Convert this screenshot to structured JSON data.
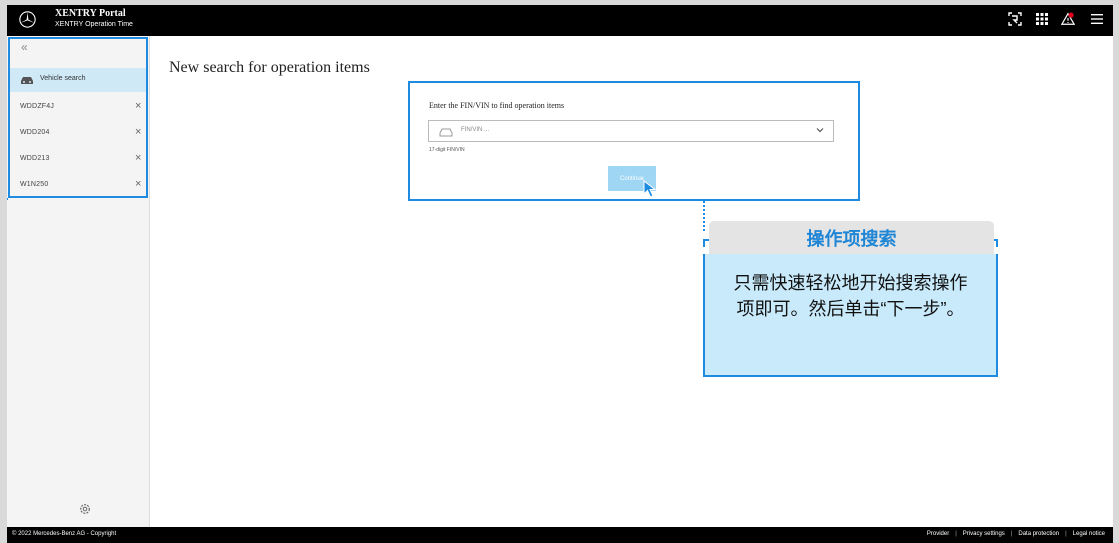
{
  "header": {
    "title": "XENTRY Portal",
    "subtitle": "XENTRY Operation Time",
    "icons": [
      "logo-star-icon",
      "scan-icon",
      "apps-grid-icon",
      "alert-icon",
      "menu-icon"
    ]
  },
  "sidebar": {
    "collapse_label": "«",
    "vehicle_search_label": "Vehicle search",
    "history": [
      {
        "label": "WDDZF4J"
      },
      {
        "label": "WDD204"
      },
      {
        "label": "WDD213"
      },
      {
        "label": "W1N250"
      }
    ],
    "close_glyph": "×"
  },
  "main": {
    "page_title": "New search for operation items",
    "search": {
      "prompt": "Enter the FIN/VIN to find operation items",
      "placeholder": "FIN/VIN ...",
      "hint": "17-digit FIN/VIN",
      "continue_label": "Continue"
    }
  },
  "callout": {
    "title": "操作项搜索",
    "body": "只需快速轻松地开始搜索操作项即可。然后单击“下一步”。"
  },
  "footer": {
    "copyright": "© 2022 Mercedes-Benz AG - Copyright",
    "links": [
      "Provider",
      "Privacy settings",
      "Data protection",
      "Legal notice"
    ]
  },
  "colors": {
    "accent": "#1e8be0",
    "highlight": "#cfe9f7",
    "callout_body": "#c8eafb",
    "button": "#9fd6f3",
    "topbar": "#000000",
    "alert": "#e0001a"
  }
}
